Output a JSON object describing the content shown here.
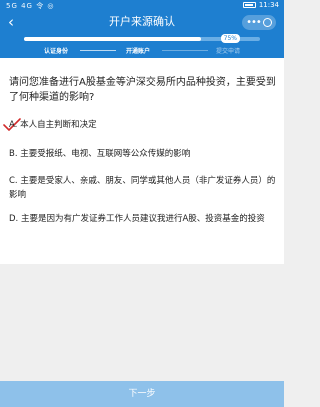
{
  "status_bar": {
    "left": "5G 4G 令 ◎",
    "time": "11:34"
  },
  "header": {
    "back_symbol": "‹",
    "title": "开户来源确认"
  },
  "progress": {
    "value": 0.75,
    "label": "75%"
  },
  "steps": [
    {
      "label": "认证身份",
      "done": true
    },
    {
      "label": "开通账户",
      "done": true
    },
    {
      "label": "提交申请",
      "done": false
    }
  ],
  "question": "请问您准备进行A股基金等沪深交易所内品种投资，主要受到了何种渠道的影响?",
  "options": [
    {
      "label": "A. 本人自主判断和决定",
      "selected": true
    },
    {
      "label": "B. 主要受报纸、电视、互联网等公众传媒的影响",
      "selected": false
    },
    {
      "label": "C. 主要是受家人、亲戚、朋友、同学或其他人员（非广发证券人员）的影响",
      "selected": false
    },
    {
      "label": "D. 主要是因为有广发证券工作人员建议我进行A股、投资基金的投资",
      "selected": false
    }
  ],
  "next_button": "下一步",
  "colors": {
    "brand": "#1e7fd0",
    "check": "#d22a2a",
    "button_disabled": "#8ec1ea"
  }
}
